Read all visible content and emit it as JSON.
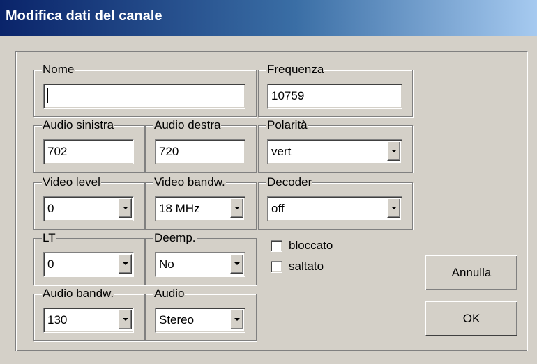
{
  "window": {
    "title": "Modifica dati del canale"
  },
  "fields": {
    "nome": {
      "label": "Nome",
      "value": ""
    },
    "frequenza": {
      "label": "Frequenza",
      "value": "10759"
    },
    "audio_sinistra": {
      "label": "Audio sinistra",
      "value": "702"
    },
    "audio_destra": {
      "label": "Audio destra",
      "value": "720"
    },
    "polarita": {
      "label": "Polarità",
      "value": "vert"
    },
    "video_level": {
      "label": "Video level",
      "value": "0"
    },
    "video_bandw": {
      "label": "Video bandw.",
      "value": "18 MHz"
    },
    "decoder": {
      "label": "Decoder",
      "value": "off"
    },
    "lt": {
      "label": "LT",
      "value": "0"
    },
    "deemp": {
      "label": "Deemp.",
      "value": "No"
    },
    "audio_bandw": {
      "label": "Audio bandw.",
      "value": "130"
    },
    "audio": {
      "label": "Audio",
      "value": "Stereo"
    }
  },
  "checkboxes": {
    "bloccato": {
      "label": "bloccato",
      "checked": false
    },
    "saltato": {
      "label": "saltato",
      "checked": false
    }
  },
  "buttons": {
    "annulla": "Annulla",
    "ok": "OK"
  },
  "icons": {
    "dropdown": "chevron-down-icon"
  }
}
